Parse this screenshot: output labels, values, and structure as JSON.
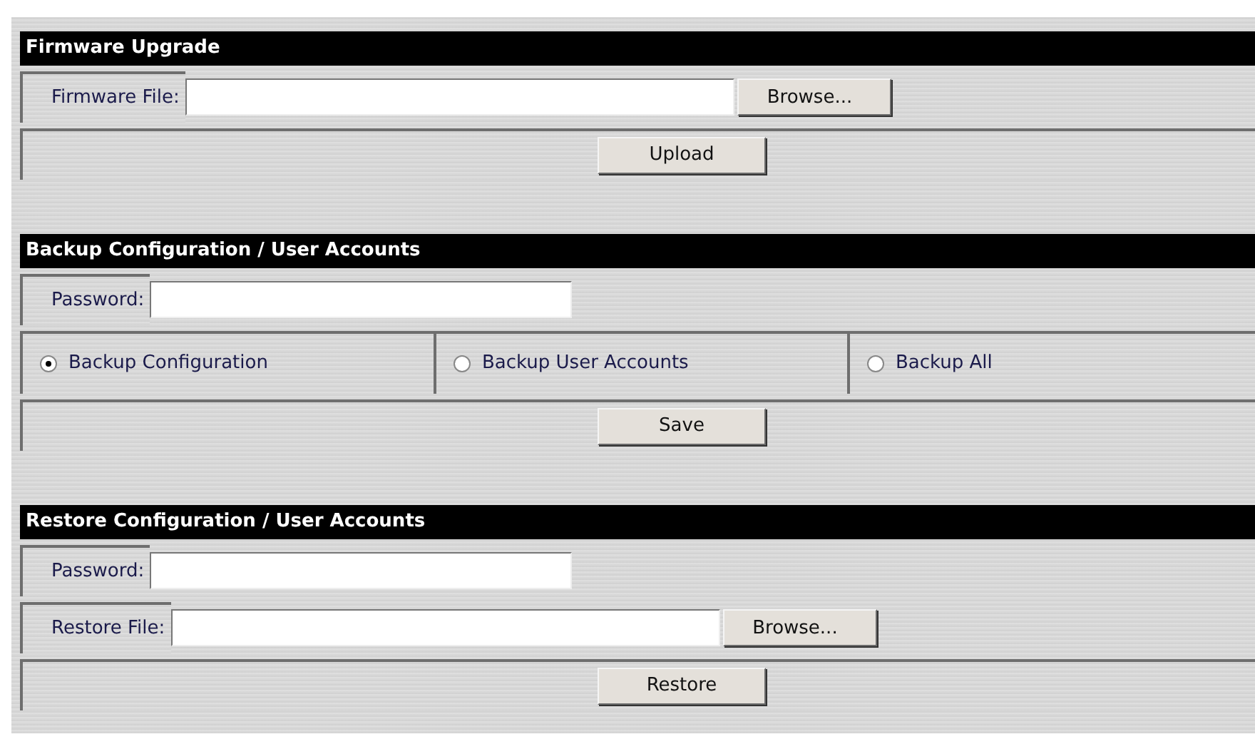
{
  "sections": [
    {
      "title": "Firmware Upgrade",
      "rows": [
        {
          "kind": "field",
          "label": "Firmware File:",
          "button": "Browse..."
        },
        {
          "kind": "action",
          "button": "Upload"
        }
      ]
    },
    {
      "title": "Backup Configuration / User Accounts",
      "rows": [
        {
          "kind": "field",
          "label": "Password:"
        },
        {
          "kind": "radios",
          "options": [
            {
              "label": "Backup Configuration",
              "selected": true
            },
            {
              "label": "Backup User Accounts",
              "selected": false
            },
            {
              "label": "Backup All",
              "selected": false
            }
          ]
        },
        {
          "kind": "action",
          "button": "Save"
        }
      ]
    },
    {
      "title": "Restore Configuration / User Accounts",
      "rows": [
        {
          "kind": "field",
          "label": "Password:"
        },
        {
          "kind": "field",
          "label": "Restore File:",
          "button": "Browse..."
        },
        {
          "kind": "action",
          "button": "Restore"
        }
      ]
    }
  ]
}
